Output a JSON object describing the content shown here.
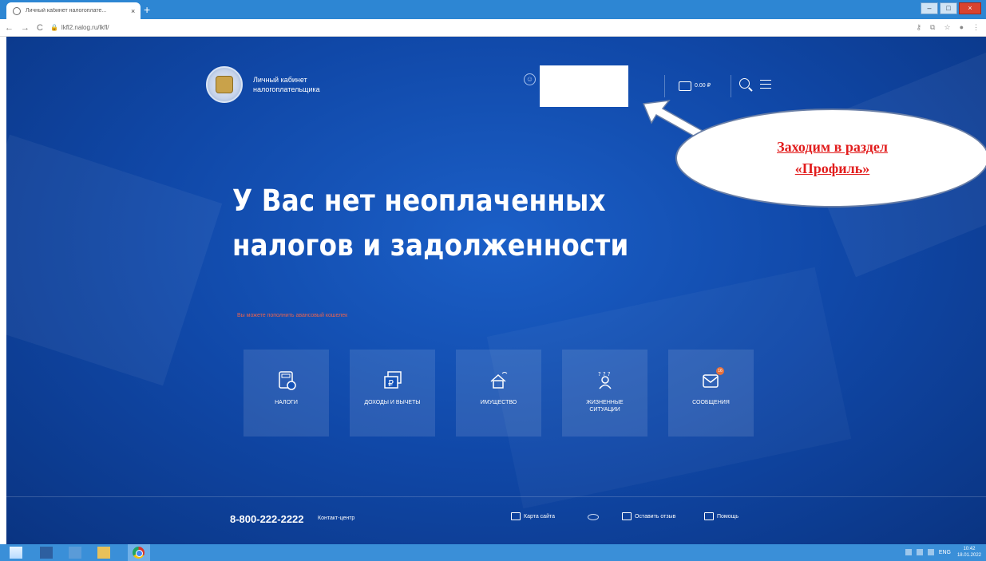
{
  "browser": {
    "tab_title": "Личный кабинет налогоплате...",
    "tab_close": "×",
    "new_tab": "+",
    "url": "lkfl2.nalog.ru/lkfl/",
    "window_buttons": [
      "–",
      "□",
      "×"
    ]
  },
  "header": {
    "brand_line1": "Личный кабинет",
    "brand_line2": "налогоплательщика",
    "wallet_amount": "0.00 ₽"
  },
  "callout": {
    "line1": "Заходим в раздел",
    "line2": "«Профиль»"
  },
  "main": {
    "headline_line1": "У Вас нет неоплаченных",
    "headline_line2": "налогов и задолженности",
    "advance_link": "Вы можете пополнить авансовый кошелек",
    "tiles": [
      {
        "label": "НАЛОГИ",
        "icon": "calculator-icon"
      },
      {
        "label": "ДОХОДЫ И ВЫЧЕТЫ",
        "icon": "ruble-bills-icon"
      },
      {
        "label": "ИМУЩЕСТВО",
        "icon": "property-icon"
      },
      {
        "label": "ЖИЗНЕННЫЕ СИТУАЦИИ",
        "icon": "person-question-icon"
      },
      {
        "label": "СООБЩЕНИЯ",
        "icon": "envelope-icon",
        "badge": "16"
      }
    ]
  },
  "footer": {
    "phone": "8-800-222-2222",
    "contact": "Контакт-центр",
    "sitemap": "Карта сайта",
    "feedback": "Оставить отзыв",
    "help": "Помощь"
  },
  "taskbar": {
    "lang": "ENG",
    "time": "10:42",
    "date": "18.01.2022"
  },
  "colors": {
    "page_bg": "#1352b8",
    "callout_text": "#e21d1d",
    "advance_link": "#e8634f",
    "taskbar": "#3a8fd8"
  }
}
